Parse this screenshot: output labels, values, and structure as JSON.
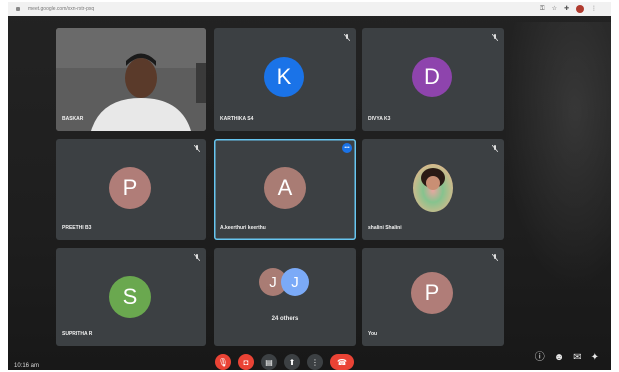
{
  "browser": {
    "url": "meet.google.com/xxn-rxtr-pxq"
  },
  "tiles": [
    {
      "name": "BASKAR"
    },
    {
      "name": "KARTHIKA S4",
      "initial": "K",
      "color": "#1a73e8"
    },
    {
      "name": "DIVYA K3",
      "initial": "D",
      "color": "#8e44ad"
    },
    {
      "name": "PREETHI B3",
      "initial": "P",
      "color": "#b07d78"
    },
    {
      "name": "A.keerthuri keerthu",
      "initial": "A",
      "color": "#a97c74"
    },
    {
      "name": "shalini Shalini"
    },
    {
      "name": "SUPRITHA R",
      "initial": "S",
      "color": "#6aa84f"
    },
    {
      "name": "24 others",
      "initial_a": "J",
      "color_a": "#a97c74",
      "initial_b": "J",
      "color_b": "#7baaf7"
    },
    {
      "name": "You",
      "initial": "P",
      "color": "#b07d78"
    }
  ],
  "controls": {
    "time": "10:16 am"
  },
  "colors": {
    "tile_bg": "#3c4043",
    "active_border": "#67c6f0",
    "end_call": "#ea4335"
  }
}
